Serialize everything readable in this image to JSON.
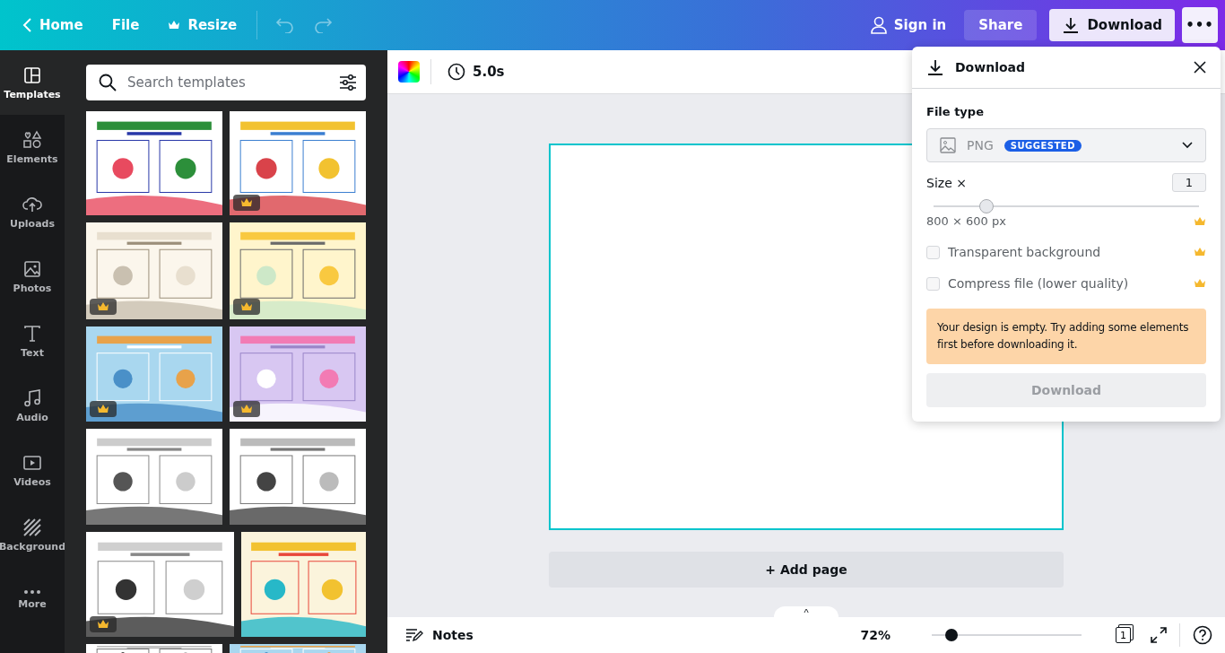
{
  "topbar": {
    "back": "Home",
    "menu": [
      "File",
      "Resize"
    ],
    "sign_in": "Sign in",
    "share": "Share",
    "download": "Download",
    "more": "•••"
  },
  "sidebar": {
    "items": [
      {
        "label": "Templates",
        "selected": true
      },
      {
        "label": "Elements",
        "selected": false
      },
      {
        "label": "Uploads",
        "selected": false
      },
      {
        "label": "Photos",
        "selected": false
      },
      {
        "label": "Text",
        "selected": false
      },
      {
        "label": "Audio",
        "selected": false
      },
      {
        "label": "Videos",
        "selected": false
      },
      {
        "label": "Background",
        "selected": false
      },
      {
        "label": "More",
        "selected": false
      }
    ]
  },
  "templates": {
    "search": {
      "placeholder": "Search templates"
    },
    "items": [
      {
        "kind": "picture",
        "premium": false
      },
      {
        "kind": "picture",
        "premium": true
      },
      {
        "kind": "picture",
        "premium": true
      },
      {
        "kind": "picture",
        "premium": true
      },
      {
        "kind": "picture",
        "premium": true
      },
      {
        "kind": "picture",
        "premium": true
      },
      {
        "kind": "picture",
        "premium": false
      },
      {
        "kind": "picture",
        "premium": false
      },
      {
        "kind": "picture",
        "premium": true
      },
      {
        "kind": "picture",
        "premium": false
      }
    ]
  },
  "toolbar": {
    "duration": "5.0s"
  },
  "canvas": {
    "add_page": "+ Add page"
  },
  "bottombar": {
    "notes": "Notes",
    "zoom": "72%",
    "zoom_slider": {
      "level": 0.13
    },
    "page_count": "1",
    "expand": "^"
  },
  "download_panel": {
    "title": "Download",
    "file_type_label": "File type",
    "file_type": "PNG",
    "badge": "SUGGESTED",
    "size_label": "Size ×",
    "size_value": "1",
    "size_slider": {
      "level": 0.2
    },
    "dimensions": "800 × 600 px",
    "dimensions_premium": true,
    "options": [
      {
        "label": "Transparent background",
        "checked": false,
        "premium": true
      },
      {
        "label": "Compress file (lower quality)",
        "checked": false,
        "premium": true
      }
    ],
    "warning": "Your design is empty. Try adding some elements first before downloading it.",
    "button": {
      "label": "Download",
      "disabled": true
    }
  }
}
